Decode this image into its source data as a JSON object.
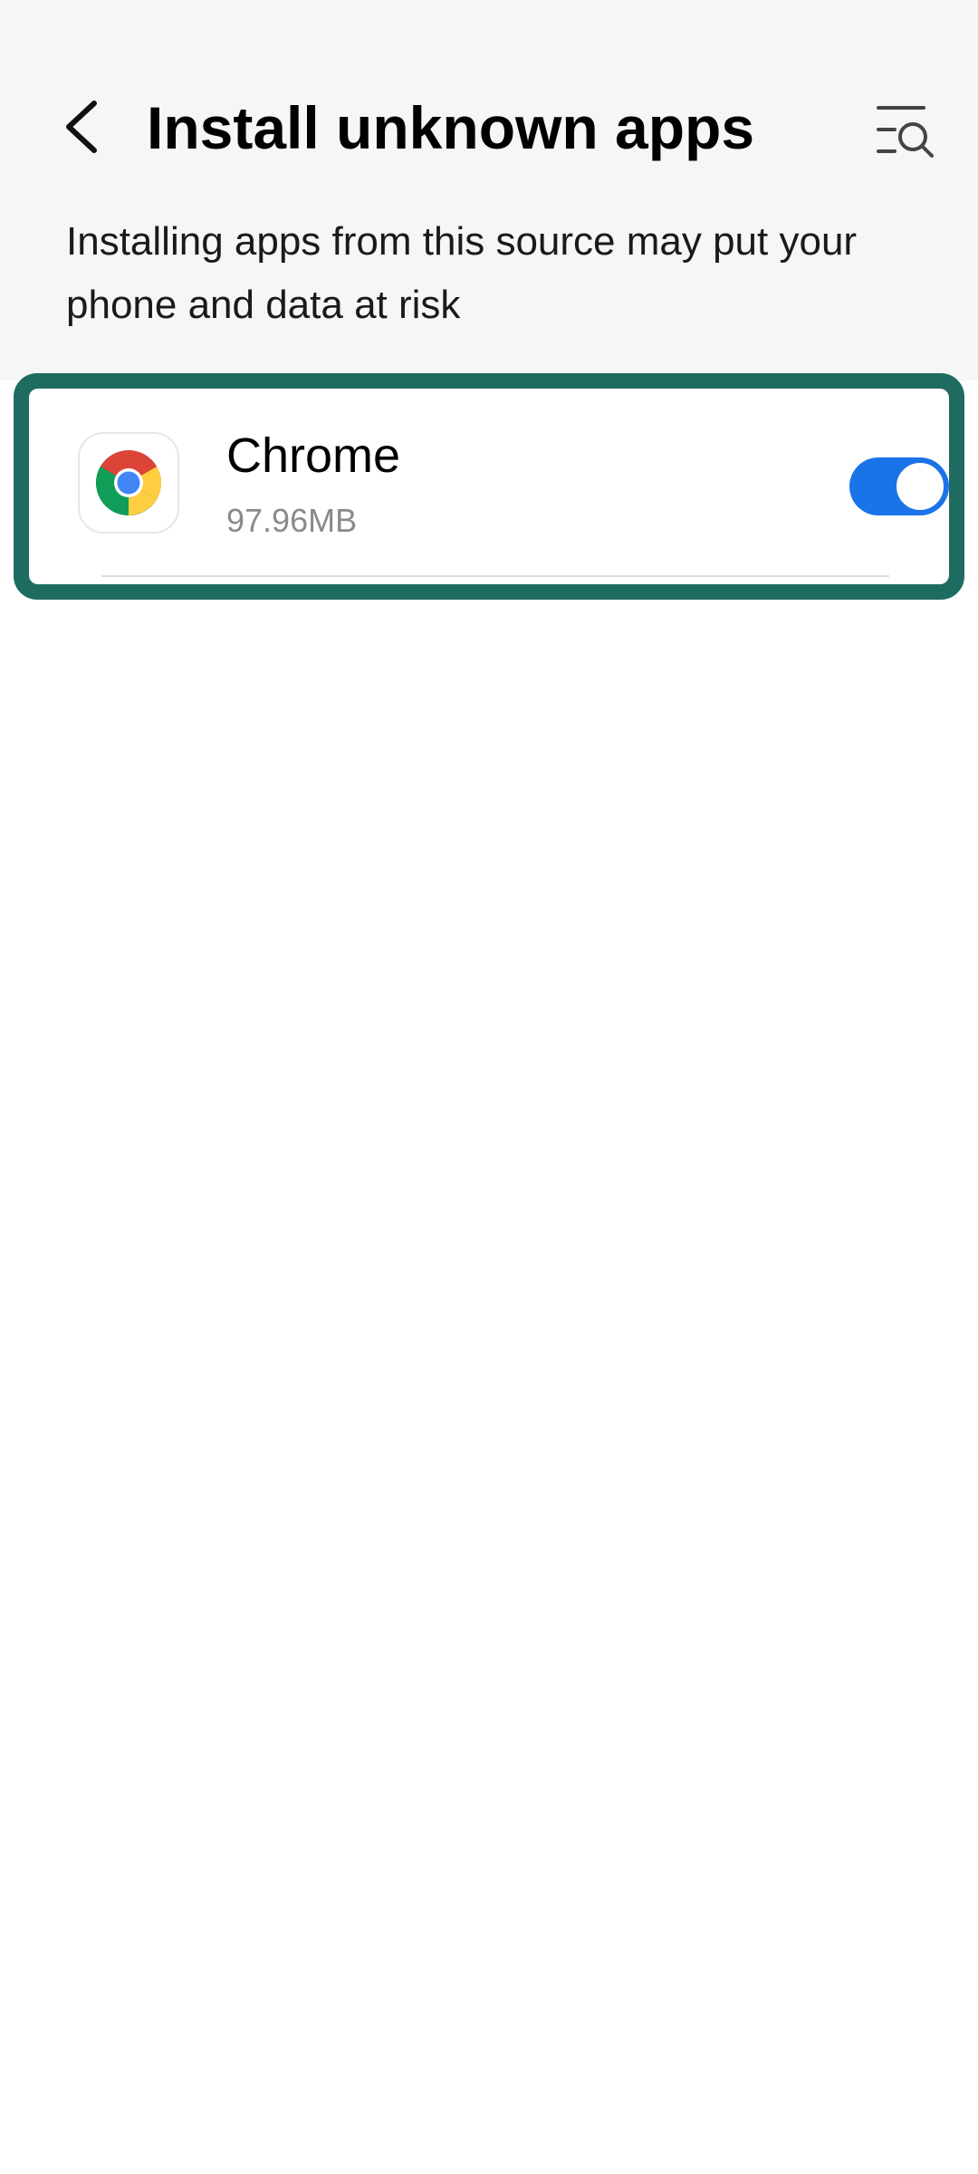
{
  "header": {
    "title": "Install unknown apps",
    "back_icon": "chevron-left-icon",
    "search_settings_icon": "list-search-icon"
  },
  "warning": {
    "text": "Installing apps from this source may put your phone and data at risk"
  },
  "apps": [
    {
      "name": "Chrome",
      "size": "97.96MB",
      "icon": "chrome-icon",
      "allowed": true
    }
  ],
  "colors": {
    "accent": "#1a73e8",
    "highlight_frame": "#1e6b62",
    "top_background": "#f6f6f6"
  }
}
